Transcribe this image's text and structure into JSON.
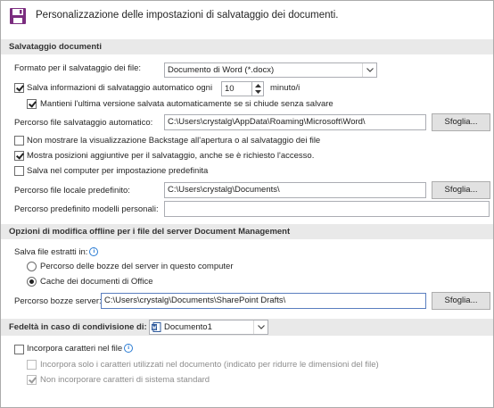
{
  "header": {
    "title": "Personalizzazione delle impostazioni di salvataggio dei documenti."
  },
  "sections": {
    "save": "Salvataggio documenti",
    "offline": "Opzioni di modifica offline per i file del server Document Management",
    "fidelity": "Fedeltà in caso di condivisione di:"
  },
  "save": {
    "format_label": "Formato per il salvataggio dei file:",
    "format_value": "Documento di Word (*.docx)",
    "autosave_label": "Salva informazioni di salvataggio automatico ogni",
    "autosave_minutes": "10",
    "autosave_unit": "minuto/i",
    "keep_last_label": "Mantieni l'ultima versione salvata automaticamente se si chiude senza salvare",
    "autorecover_path_label": "Percorso file salvataggio automatico:",
    "autorecover_path_value": "C:\\Users\\crystalg\\AppData\\Roaming\\Microsoft\\Word\\",
    "browse_label": "Sfoglia...",
    "no_backstage_label": "Non mostrare la visualizzazione Backstage all'apertura o al salvataggio dei file",
    "show_places_label": "Mostra posizioni aggiuntive per il salvataggio, anche se è richiesto l'accesso.",
    "save_to_computer_label": "Salva nel computer per impostazione predefinita",
    "local_path_label": "Percorso file locale predefinito:",
    "local_path_value": "C:\\Users\\crystalg\\Documents\\",
    "templates_path_label": "Percorso predefinito modelli personali:",
    "templates_path_value": ""
  },
  "offline": {
    "save_checked_out_label": "Salva file estratti in:",
    "radio_server_drafts": "Percorso delle bozze del server in questo computer",
    "radio_office_cache": "Cache dei documenti di Office",
    "drafts_path_label": "Percorso bozze server:",
    "drafts_path_value": "C:\\Users\\crystalg\\Documents\\SharePoint Drafts\\",
    "browse_label": "Sfoglia..."
  },
  "fidelity": {
    "document_value": "Documento1",
    "embed_fonts_label": "Incorpora caratteri nel file",
    "embed_only_used_label": "Incorpora solo i caratteri utilizzati nel documento (indicato per ridurre le dimensioni del file)",
    "no_system_fonts_label": "Non incorporare caratteri di sistema standard"
  },
  "icons": {
    "save": "floppy-disk-icon",
    "info": "info-icon",
    "word_doc": "word-document-icon",
    "dropdown": "chevron-down-icon"
  },
  "colors": {
    "accent": "#7b2d7f",
    "section_bg": "#e9e9e9",
    "focus_border": "#5a7ebf"
  }
}
